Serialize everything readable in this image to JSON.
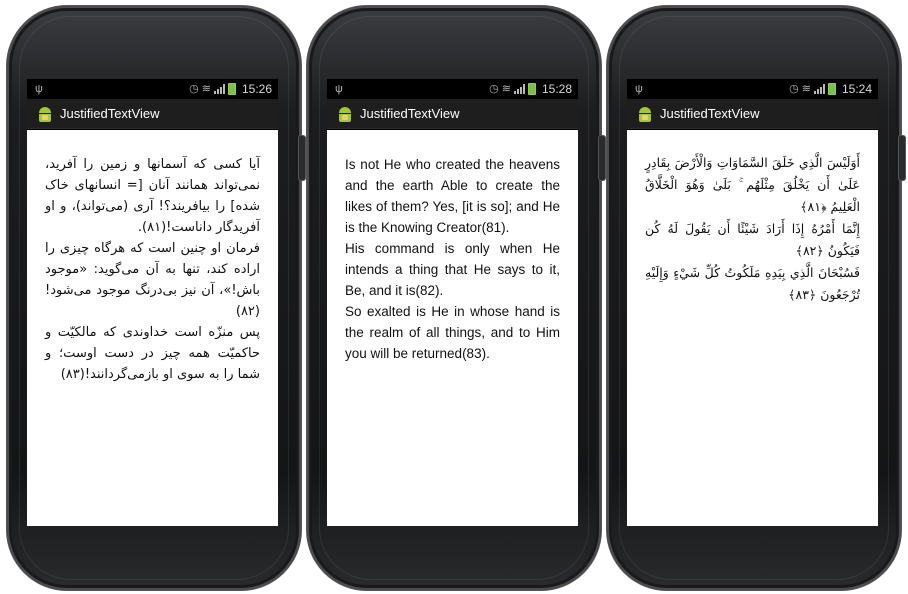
{
  "status_bar": {
    "icons": [
      "usb-icon",
      "alarm-icon",
      "wifi-icon",
      "signal-icon",
      "battery-icon"
    ]
  },
  "phones": [
    {
      "time": "15:26",
      "app_title": "JustifiedTextView",
      "direction": "rtl",
      "paragraphs": [
        "آیا کسی که آسمانها و زمین را آفرید، نمی‌تواند همانند آنان [= انسانهای خاک شده] را بیافریند؟! آری (می‌تواند)، و او آفریدگار داناست!(۸۱).",
        "فرمان او چنین است که هرگاه چیزی را اراده کند، تنها به آن می‌گوید: «موجود باش!»، آن نیز بی‌درنگ موجود می‌شود!(۸۲)",
        "پس منزّه است خداوندی که مالکیّت و حاکمیّت همه چیز در دست اوست؛ و شما را به سوی او بازمی‌گردانند!(۸۳)"
      ]
    },
    {
      "time": "15:28",
      "app_title": "JustifiedTextView",
      "direction": "ltr",
      "paragraphs": [
        "Is not He who created the heavens and the earth Able to create the likes of them? Yes, [it is so]; and He is the Knowing Creator(81).",
        "His command is only when He intends a thing that He says to it, Be, and it is(82).",
        "So exalted is He in whose hand is the realm of all things, and to Him you will be returned(83)."
      ]
    },
    {
      "time": "15:24",
      "app_title": "JustifiedTextView",
      "direction": "rtl",
      "paragraphs": [
        "أَوَلَيْسَ الَّذِي خَلَقَ السَّمَاوَاتِ وَالْأَرْضَ بِقَادِرٍ عَلَىٰ أَن يَخْلُقَ مِثْلَهُم ۚ بَلَىٰ وَهُوَ الْخَلَّاقُ الْعَلِيمُ ﴿٨١﴾",
        "إِنَّمَا أَمْرُهُ إِذَا أَرَادَ شَيْئًا أَن يَقُولَ لَهُ كُن فَيَكُونُ ﴿٨٢﴾",
        "فَسُبْحَانَ الَّذِي بِيَدِهِ مَلَكُوتُ كُلِّ شَيْءٍ وَإِلَيْهِ تُرْجَعُونَ ﴿٨٣﴾"
      ]
    }
  ]
}
